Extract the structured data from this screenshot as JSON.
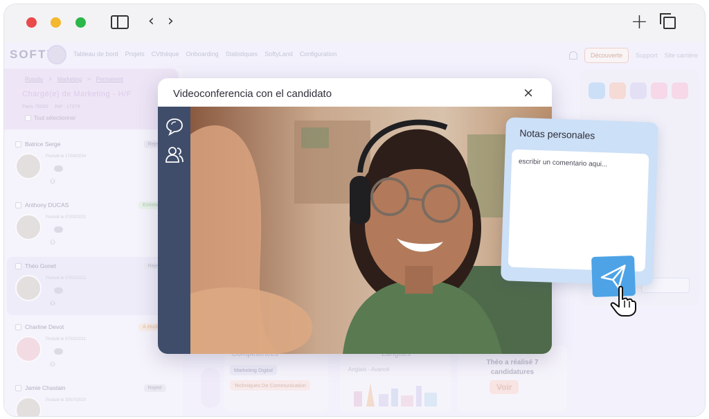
{
  "window": {
    "controls": [
      "close",
      "minimize",
      "maximize"
    ],
    "colors": {
      "close": "#e94a4a",
      "minimize": "#f3b82d",
      "maximize": "#2bb74a"
    }
  },
  "app": {
    "logo": "SOFTY",
    "nav": [
      "Tableau de bord",
      "Projets",
      "CVthèque",
      "Onboarding",
      "Statistiques",
      "SoftyLand",
      "Configuration"
    ],
    "decouverte": "Découverte",
    "support": "Support",
    "site_carriere": "Site carrière"
  },
  "job": {
    "breadcrumb": [
      "Rossilo",
      "Marketing",
      "Permanent"
    ],
    "title": "Chargé(e) de Marketing - H/F",
    "location": "Paris 75000",
    "ref": "Réf : 17379",
    "select_all": "Tout sélectionner"
  },
  "candidates": [
    {
      "name": "Batrice Serge",
      "date": "Postulé le 17/04/2024",
      "status": "Rejeté",
      "status_type": "rejete"
    },
    {
      "name": "Anthony DUCAS",
      "date": "Postulé le 07/02/2021",
      "status": "Entretien",
      "status_type": "entretien"
    },
    {
      "name": "Théo Gonet",
      "date": "Postulé le 07/02/2021",
      "status": "Rejeté",
      "status_type": "rejete"
    },
    {
      "name": "Charline Devot",
      "date": "Postulé le 07/02/2021",
      "status": "À étudier",
      "status_type": "etude"
    },
    {
      "name": "Jamie Chastain",
      "date": "Postulé le 30/07/2020",
      "status": "Rejeté",
      "status_type": "rejete"
    }
  ],
  "profile": {
    "competences_title": "Compétences",
    "skills": [
      "Marketing Digital",
      "Techniques De Communication"
    ],
    "langues_title": "Langues",
    "langue": "Anglais - Avancé",
    "theo_text": "Théo a réalisé 7 candidatures",
    "voir": "Voir"
  },
  "modal": {
    "title": "Videoconferencia con el candidato",
    "close": "×"
  },
  "notes": {
    "title": "Notas personales",
    "placeholder": "escribir un comentario aqui..."
  }
}
